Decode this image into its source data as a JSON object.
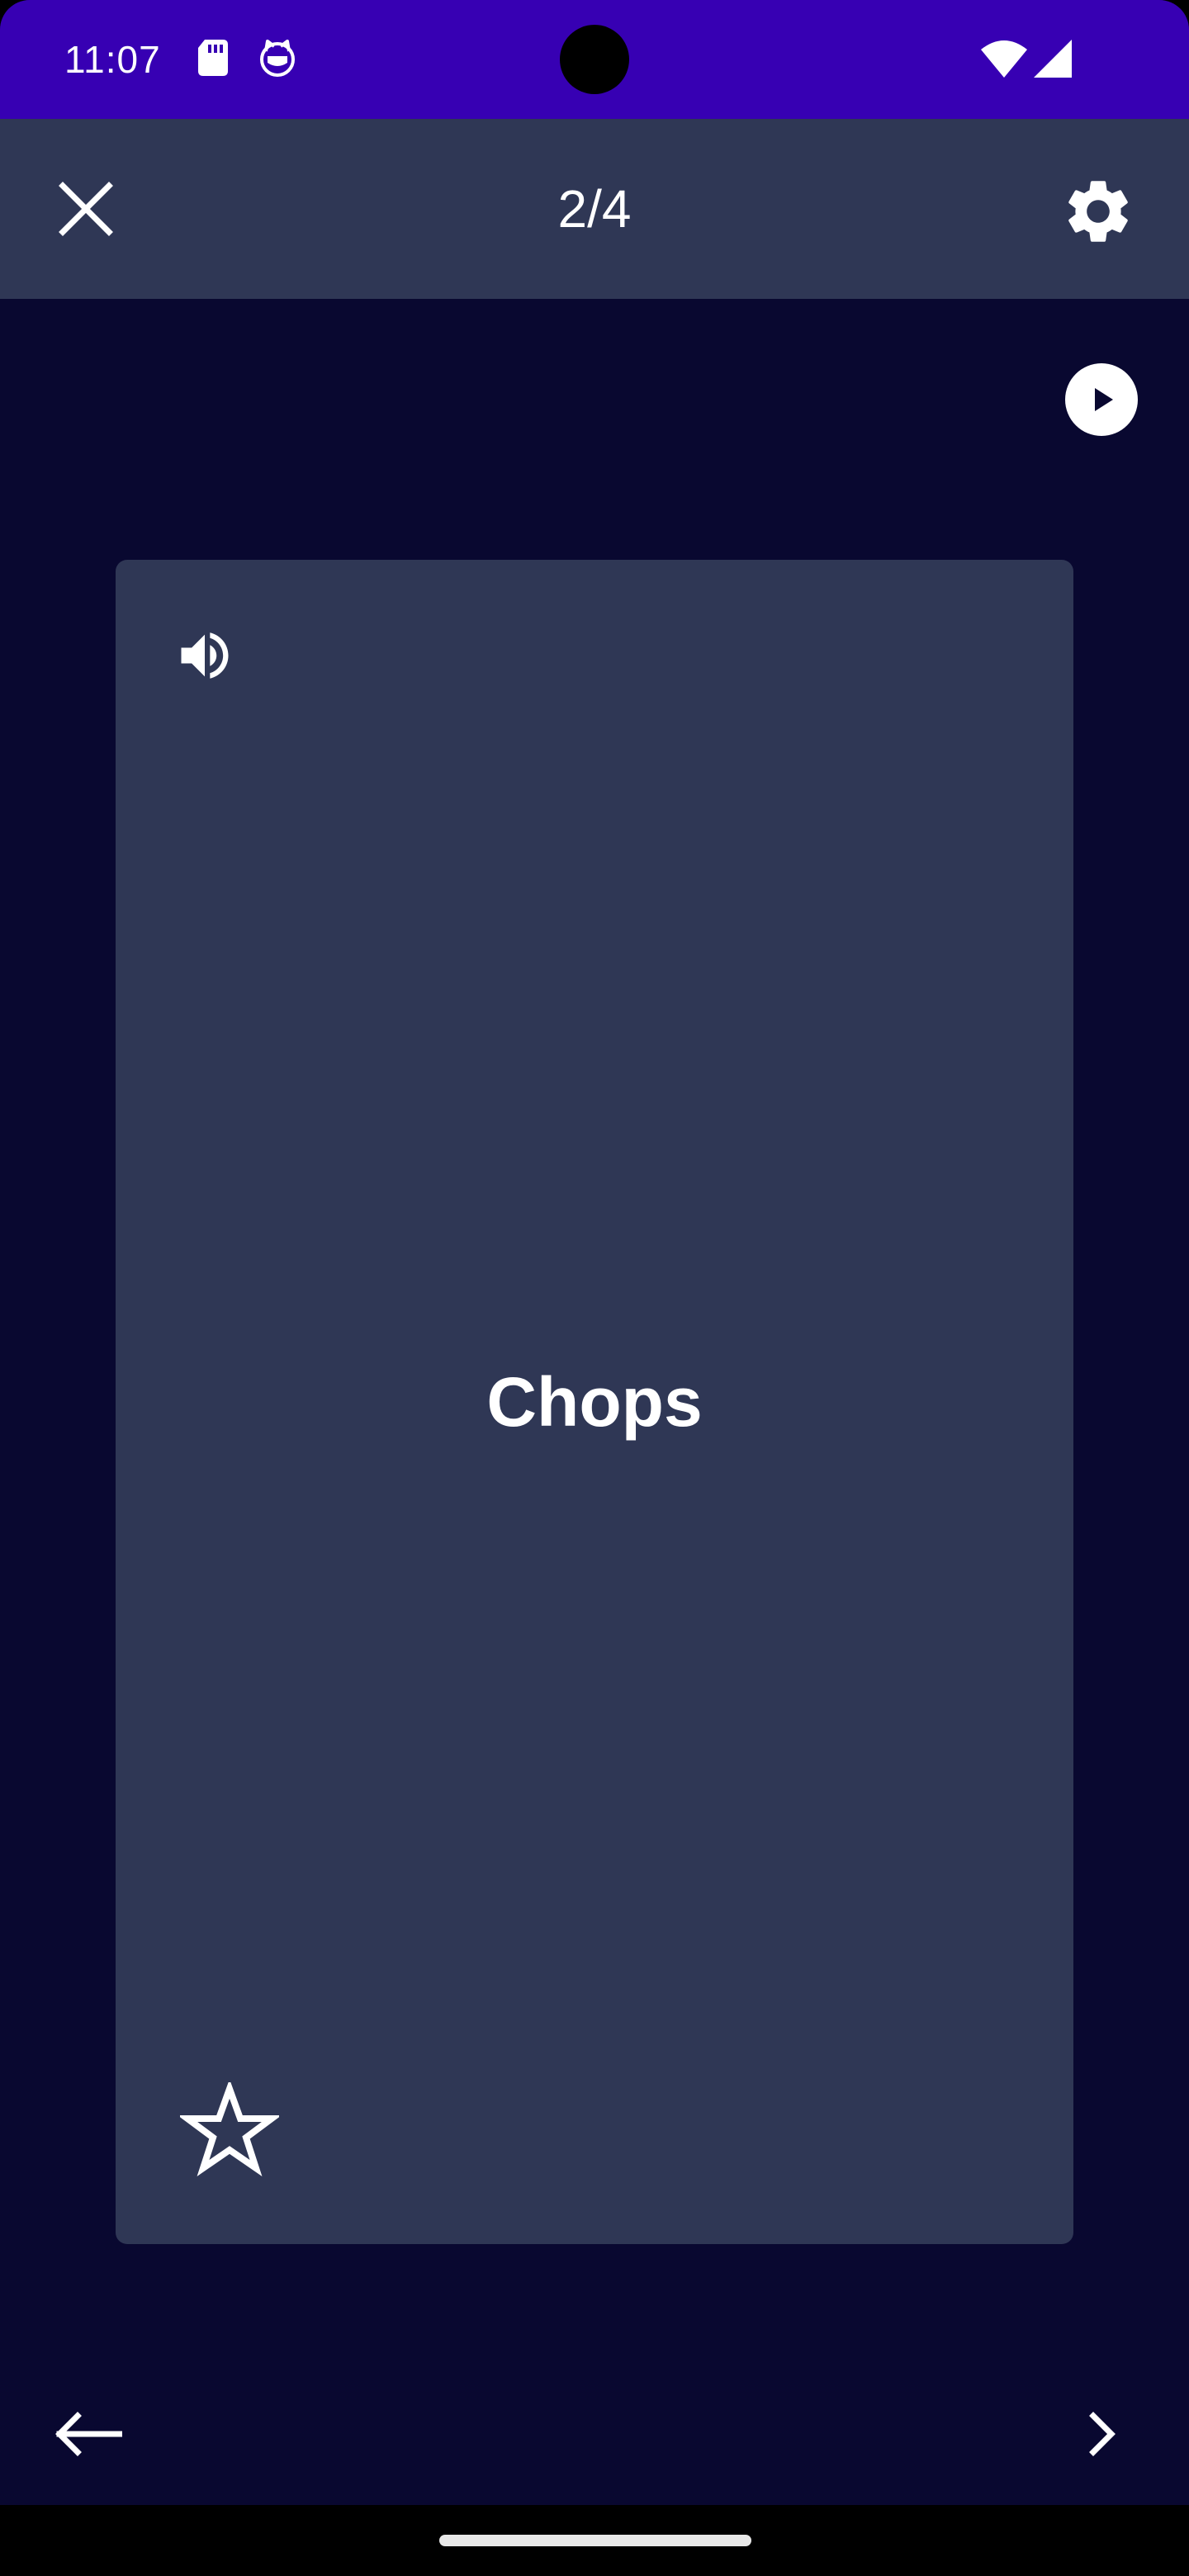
{
  "status_bar": {
    "time": "11:07",
    "icons": [
      "sd-card-icon",
      "cat-icon",
      "wifi-icon",
      "cellular-signal-icon"
    ]
  },
  "toolbar": {
    "close_icon": "close-icon",
    "progress": "2/4",
    "settings_icon": "gear-icon"
  },
  "autoplay": {
    "icon": "play-circle-icon"
  },
  "card": {
    "term": "Chops",
    "audio_icon": "speaker-icon",
    "favorite_icon": "star-outline-icon"
  },
  "navigation": {
    "previous_icon": "arrow-left-icon",
    "next_icon": "chevron-right-icon"
  },
  "colors": {
    "status_bar": "#3700b3",
    "background": "#090830",
    "surface": "#2f3755",
    "text": "#ffffff"
  }
}
